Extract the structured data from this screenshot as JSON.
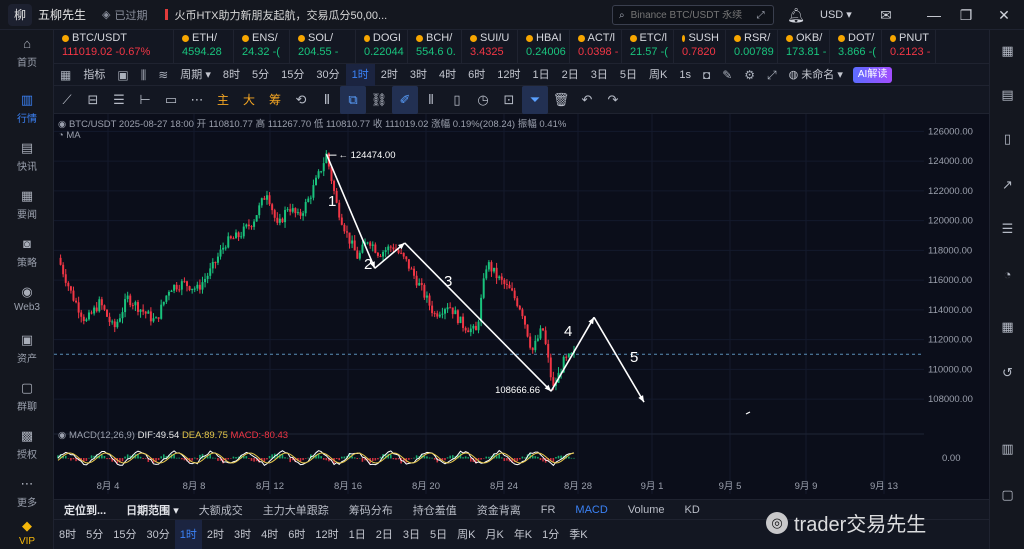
{
  "topbar": {
    "app_name": "五柳先生",
    "expired_label": "已过期",
    "news_text": "火币HTX助力新朋友起航，交易瓜分50,00...",
    "search_placeholder": "Binance BTC/USDT 永续",
    "currency": "USD"
  },
  "sidebar": {
    "items": [
      {
        "label": "首页",
        "icon": "home-icon"
      },
      {
        "label": "行情",
        "icon": "chart-bars-icon"
      },
      {
        "label": "快讯",
        "icon": "flash-news-icon"
      },
      {
        "label": "要闻",
        "icon": "news-icon"
      },
      {
        "label": "策略",
        "icon": "robot-icon"
      },
      {
        "label": "Web3",
        "icon": "web3-icon"
      },
      {
        "label": "资产",
        "icon": "wallet-icon"
      },
      {
        "label": "群聊",
        "icon": "chat-icon"
      },
      {
        "label": "授权",
        "icon": "key-icon"
      },
      {
        "label": "更多",
        "icon": "more-icon"
      },
      {
        "label": "VIP",
        "icon": "vip-icon"
      }
    ]
  },
  "tickers": [
    {
      "symbol": "BTC/USDT",
      "price": "111019.02",
      "change": "-0.67%",
      "dir": "dn"
    },
    {
      "symbol": "ETH/",
      "price": "4594.28",
      "change": "",
      "dir": "up"
    },
    {
      "symbol": "ENS/",
      "price": "24.32",
      "change": "-(",
      "dir": "up"
    },
    {
      "symbol": "SOL/",
      "price": "204.55",
      "change": "-",
      "dir": "up"
    },
    {
      "symbol": "DOGI",
      "price": "0.22044",
      "change": "",
      "dir": "up"
    },
    {
      "symbol": "BCH/",
      "price": "554.6",
      "change": "0.",
      "dir": "up"
    },
    {
      "symbol": "SUI/U",
      "price": "3.4325",
      "change": "",
      "dir": "dn"
    },
    {
      "symbol": "HBAI",
      "price": "0.24006",
      "change": "",
      "dir": "up"
    },
    {
      "symbol": "ACT/l",
      "price": "0.0398",
      "change": "-",
      "dir": "dn"
    },
    {
      "symbol": "ETC/l",
      "price": "21.57",
      "change": "-(",
      "dir": "up"
    },
    {
      "symbol": "SUSH",
      "price": "0.7820",
      "change": "",
      "dir": "dn"
    },
    {
      "symbol": "RSR/",
      "price": "0.00789",
      "change": "",
      "dir": "up"
    },
    {
      "symbol": "OKB/",
      "price": "173.81",
      "change": "-",
      "dir": "up"
    },
    {
      "symbol": "DOT/",
      "price": "3.866",
      "change": "-(",
      "dir": "up"
    },
    {
      "symbol": "PNUT",
      "price": "0.2123",
      "change": "-",
      "dir": "dn"
    }
  ],
  "toolbar1": {
    "indicator": "指标",
    "period": "周期",
    "intervals": [
      "8时",
      "5分",
      "15分",
      "30分",
      "1时",
      "2时",
      "3时",
      "4时",
      "6时",
      "12时",
      "1日",
      "2日",
      "3日",
      "5日",
      "周K"
    ],
    "selected_interval": "1时",
    "one_second": "1s",
    "unnamed": "未命名",
    "ai_label": "AI解读"
  },
  "toolbar2": {
    "text_tools": [
      "主",
      "大",
      "筹"
    ]
  },
  "chart_info": {
    "pair": "BTC/USDT",
    "datetime": "2025-08-27 18:00",
    "open": "开 110810.77",
    "high": "高 111267.70",
    "low": "低 110810.77",
    "close": "收 111019.02",
    "change": "涨幅 0.19%(208.24)",
    "amplitude": "振幅 0.41%",
    "ma_label": "MA",
    "macd_label": "MACD(12,26,9)",
    "dif": "DIF:49.54",
    "dea": "DEA:89.75",
    "macd_val": "MACD:-80.43"
  },
  "chart_data": {
    "type": "line",
    "series_kind": "candlestick-price-with-wave-annotation",
    "x_ticks": [
      "8月 4",
      "8月 8",
      "8月 12",
      "8月 16",
      "8月 20",
      "8月 24",
      "8月 28",
      "9月 1",
      "9月 5",
      "9月 9",
      "9月 13"
    ],
    "y_ticks": [
      "126000.00",
      "124000.00",
      "122000.00",
      "120000.00",
      "118000.00",
      "116000.00",
      "114000.00",
      "112000.00",
      "110000.00",
      "108000.00"
    ],
    "ylim": [
      107000,
      126500
    ],
    "macd_zero_label": "0.00",
    "current_price": 111019.02,
    "annotations": {
      "high_label": "124474.00",
      "low_label": "108666.66"
    },
    "price_path": [
      {
        "t": 0,
        "v": 117500
      },
      {
        "t": 0.02,
        "v": 115000
      },
      {
        "t": 0.04,
        "v": 113200
      },
      {
        "t": 0.06,
        "v": 114500
      },
      {
        "t": 0.08,
        "v": 112700
      },
      {
        "t": 0.1,
        "v": 114800
      },
      {
        "t": 0.12,
        "v": 114000
      },
      {
        "t": 0.14,
        "v": 113200
      },
      {
        "t": 0.16,
        "v": 115500
      },
      {
        "t": 0.18,
        "v": 115800
      },
      {
        "t": 0.2,
        "v": 115400
      },
      {
        "t": 0.22,
        "v": 116700
      },
      {
        "t": 0.24,
        "v": 118500
      },
      {
        "t": 0.26,
        "v": 119000
      },
      {
        "t": 0.28,
        "v": 120000
      },
      {
        "t": 0.3,
        "v": 122000
      },
      {
        "t": 0.315,
        "v": 119500
      },
      {
        "t": 0.33,
        "v": 121000
      },
      {
        "t": 0.345,
        "v": 120200
      },
      {
        "t": 0.36,
        "v": 121500
      },
      {
        "t": 0.375,
        "v": 123200
      },
      {
        "t": 0.385,
        "v": 124474
      },
      {
        "t": 0.4,
        "v": 121000
      },
      {
        "t": 0.415,
        "v": 119000
      },
      {
        "t": 0.43,
        "v": 117500
      },
      {
        "t": 0.445,
        "v": 118800
      },
      {
        "t": 0.46,
        "v": 117800
      },
      {
        "t": 0.48,
        "v": 118300
      },
      {
        "t": 0.5,
        "v": 117200
      },
      {
        "t": 0.52,
        "v": 115500
      },
      {
        "t": 0.54,
        "v": 113700
      },
      {
        "t": 0.56,
        "v": 114400
      },
      {
        "t": 0.58,
        "v": 113000
      },
      {
        "t": 0.6,
        "v": 112500
      },
      {
        "t": 0.615,
        "v": 117200
      },
      {
        "t": 0.63,
        "v": 116200
      },
      {
        "t": 0.65,
        "v": 115200
      },
      {
        "t": 0.665,
        "v": 114000
      },
      {
        "t": 0.68,
        "v": 111200
      },
      {
        "t": 0.695,
        "v": 112800
      },
      {
        "t": 0.71,
        "v": 108666
      },
      {
        "t": 0.725,
        "v": 110500
      },
      {
        "t": 0.74,
        "v": 111019
      }
    ],
    "wave_labels": [
      "1",
      "2",
      "3",
      "4",
      "5"
    ],
    "wave_path": [
      {
        "x_date": "8月 14",
        "y": 124474
      },
      {
        "x_date": "8月 16",
        "y": 116800
      },
      {
        "x_date": "8月 18",
        "y": 118500
      },
      {
        "x_date": "8月 26",
        "y": 108666
      },
      {
        "x_date": "8月 29",
        "y": 113500
      },
      {
        "x_date": "9月 1",
        "y": 107800
      }
    ]
  },
  "bottom1": {
    "items": [
      "定位到...",
      "日期范围",
      "大额成交",
      "主力大单跟踪",
      "筹码分布",
      "持仓羞值",
      "资金背离",
      "FR",
      "MACD",
      "Volume",
      "KD"
    ],
    "selected": "MACD"
  },
  "bottom2": {
    "items": [
      "8时",
      "5分",
      "15分",
      "30分",
      "1时",
      "2时",
      "3时",
      "4时",
      "6时",
      "12时",
      "1日",
      "2日",
      "3日",
      "5日",
      "周K",
      "月K",
      "年K",
      "1分",
      "季K"
    ],
    "selected": "1时"
  },
  "watermark": {
    "text": "trader交易先生"
  },
  "colors": {
    "up": "#19c37d",
    "down": "#f23645",
    "accent": "#3b82f6",
    "annotation": "#ffffff"
  }
}
